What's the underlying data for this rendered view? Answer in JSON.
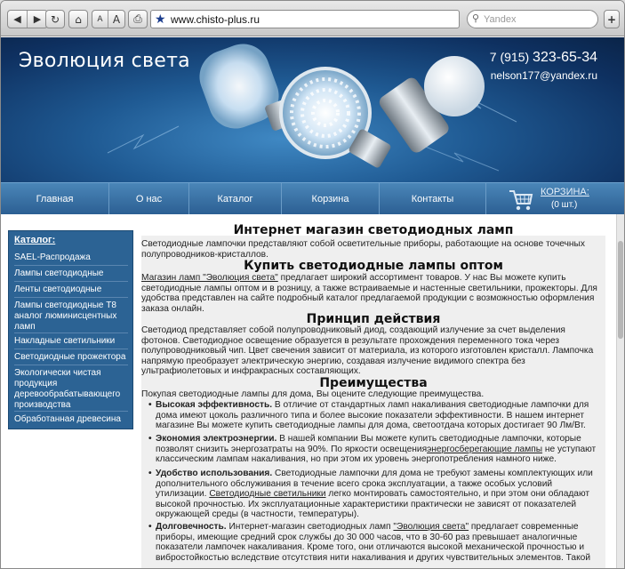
{
  "browser": {
    "back_icon": "back-arrow-icon",
    "forward_icon": "forward-arrow-icon",
    "reload_icon": "reload-icon",
    "home_icon": "home-icon",
    "font_small": "A",
    "font_large": "A",
    "print_icon": "print-icon",
    "url": "www.chisto-plus.ru",
    "search_placeholder": "Yandex",
    "add_label": "+"
  },
  "header": {
    "title": "Эволюция света",
    "phone_code": "7 (915)",
    "phone_number": "323-65-34",
    "email": "nelson177@yandex.ru"
  },
  "nav": {
    "items": [
      "Главная",
      "О нас",
      "Каталог",
      "Корзина",
      "Контакты"
    ],
    "cart_label": "КОРЗИНА:",
    "cart_count": "(0 шт.)"
  },
  "sidebar": {
    "heading": "Каталог:",
    "items": [
      "SAEL-Распродажа",
      "Лампы светодиодные",
      "Ленты светодиодные",
      "Лампы светодиодные Т8 аналог люминисцентных ламп",
      "Накладные светильники",
      "Светодиодные прожектора",
      "Экологически чистая продукция деревообрабатывающего производства",
      "Обработанная древесина"
    ]
  },
  "main": {
    "h1": "Интернет магазин светодиодных ламп",
    "p1": "Светодиодные лампочки представляют собой осветительные приборы, работающие на основе точечных полупроводников-кристаллов.",
    "h2": "Купить светодиодные лампы оптом",
    "p2_link": "Магазин ламп \"Эволюция света\"",
    "p2": " предлагает широкий ассортимент товаров. У нас Вы можете купить светодиодные лампы оптом и в розницу, а также встраиваемые и настенные светильники, прожекторы. Для удобства представлен на сайте подробный каталог предлагаемой продукции с возможностью оформления заказа онлайн.",
    "h3": "Принцип действия",
    "p3": "Светодиод представляет собой полупроводниковый диод, создающий излучение за счет выделения фотонов. Светодиодное освещение образуется в результате прохождения переменного тока через полупроводниковый чип. Цвет свечения зависит от материала, из которого изготовлен кристалл. Лампочка напрямую преобразует электрическую энергию, создавая излучение видимого спектра без ультрафиолетовых и инфракрасных составляющих.",
    "h4": "Преимущества",
    "p4": "Покупая светодиодные лампы для дома, Вы оцените следующие преимущества.",
    "b1_title": "Высокая эффективность.",
    "b1": " В отличие от стандартных ламп накаливания светодиодные лампочки для дома имеют цоколь различного типа и более высокие показатели эффективности. В нашем интернет магазине Вы можете купить светодиодные лампы для дома, светоотдача которых достигает 90 Лм/Вт.",
    "b2_title": "Экономия электроэнергии.",
    "b2a": " В нашей компании Вы можете купить светодиодные лампочки, которые позволят снизить энергозатраты на 90%. По яркости освещения",
    "b2_link": "энергосберегающие лампы",
    "b2b": " не уступают классическим лампам накаливания, но при этом их уровень энергопотребления намного ниже.",
    "b3_title": "Удобство использования.",
    "b3a": " Светодиодные лампочки для дома не требуют замены комплектующих или дополнительного обслуживания в течение всего срока эксплуатации, а также особых условий утилизации. ",
    "b3_link": "Светодиодные светильники",
    "b3b": " легко монтировать самостоятельно, и при этом они обладают высокой прочностью. Их эксплуатационные характеристики практически не зависят от показателей окружающей среды (в частности, температуры).",
    "b4_title": "Долговечность.",
    "b4a": " Интернет-магазин светодиодных ламп ",
    "b4_link": "\"Эволюция света\"",
    "b4b": " предлагает современные приборы, имеющие средний срок службы до 30 000 часов, что в 30-60 раз превышает аналогичные показатели лампочек накаливания. Кроме того, они отличаются высокой механической прочностью и вибростойкостью вследствие отсутствия нити накаливания и других чувствительных элементов. Такой"
  },
  "colors": {
    "header_bg": "#1f5a93",
    "nav_bg": "#3a73a6",
    "sidebar_bg": "#2c6394"
  }
}
